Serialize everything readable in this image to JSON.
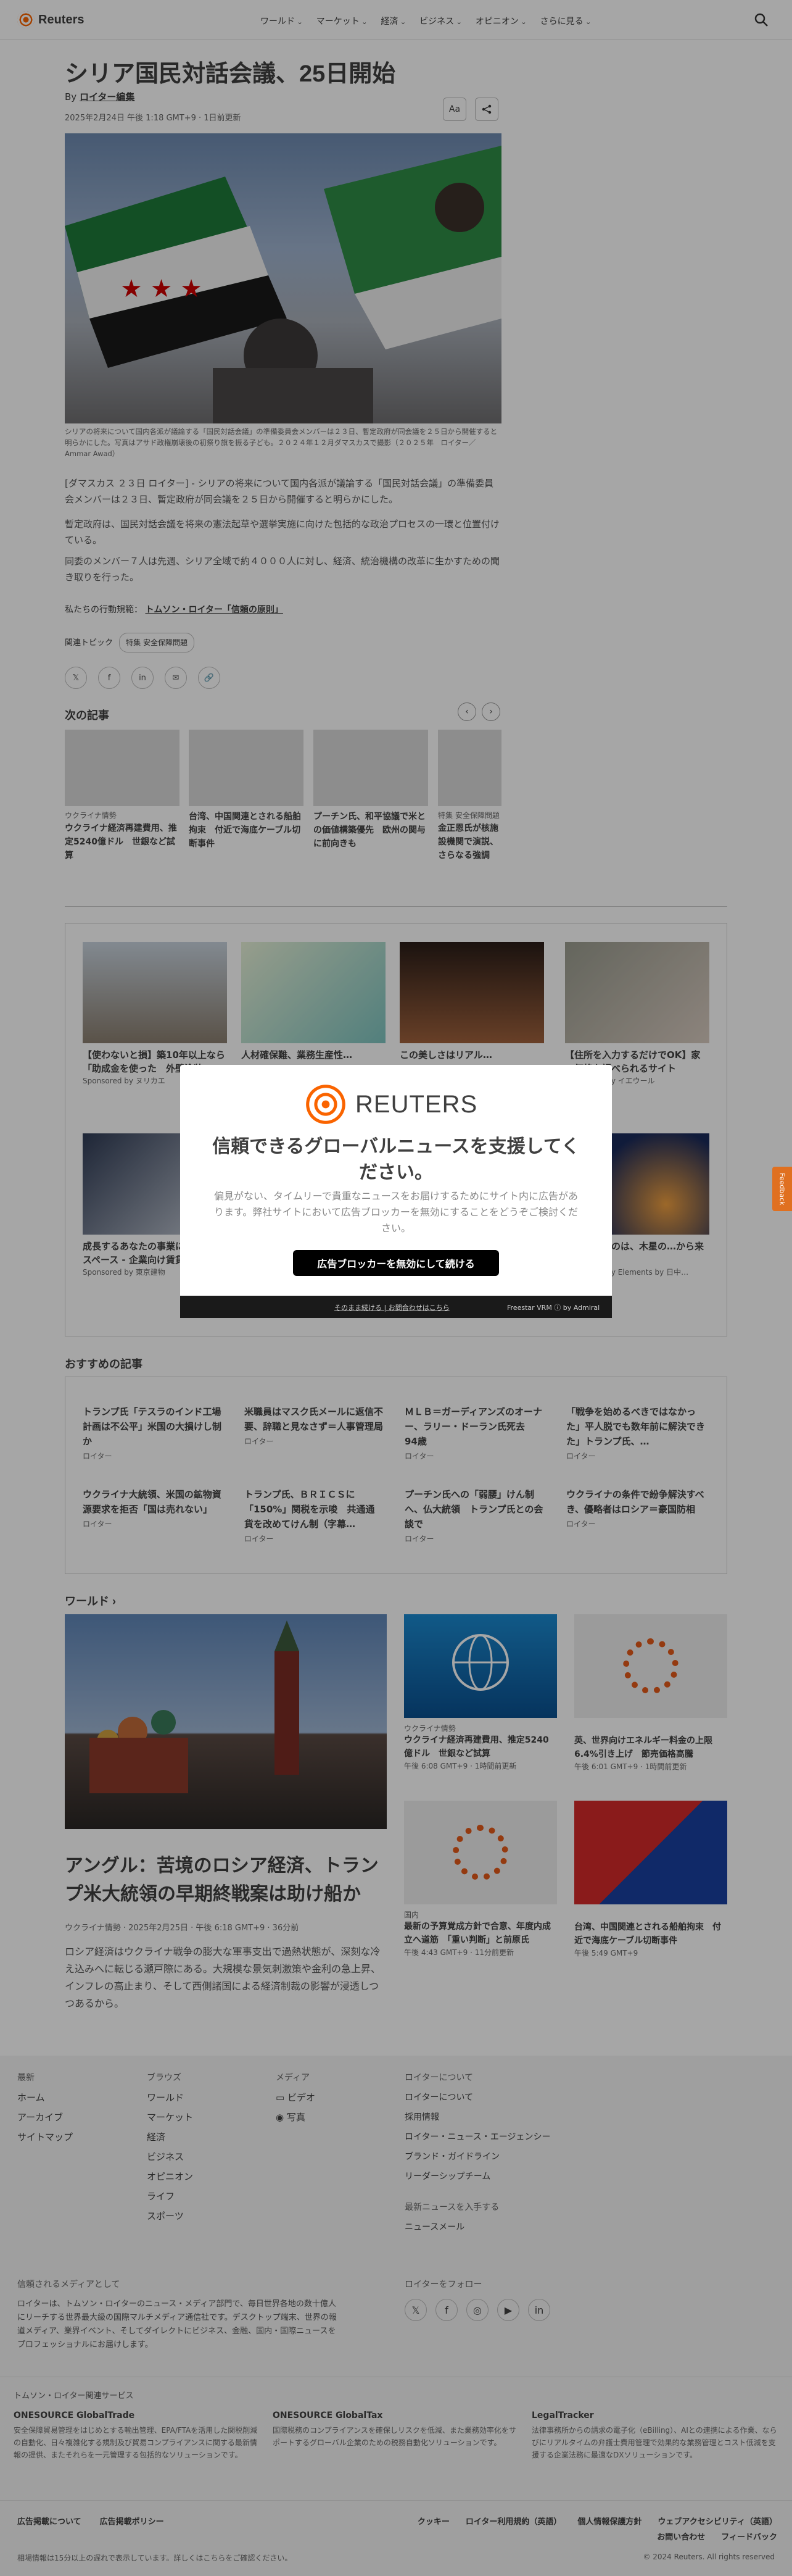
{
  "header": {
    "logo": "Reuters",
    "nav": [
      "ワールド",
      "マーケット",
      "経済",
      "ビジネス",
      "オピニオン",
      "さらに見る"
    ]
  },
  "article": {
    "title": "シリア国民対話会議、25日開始",
    "byline_prefix": "By",
    "author": "ロイター編集",
    "date": "2025年2月24日 午後 1:18 GMT+9 · 1日前更新",
    "font_button": "Aa",
    "caption": "シリアの将来について国内各派が議論する「国民対話会議」の準備委員会メンバーは２３日、暫定政府が同会議を２５日から開催すると明らかにした。写真はアサド政権崩壊後の初祭り旗を振る子ども。２０２４年１２月ダマスカスで撮影（２０２５年　ロイター／Ammar Awad）",
    "paragraphs": [
      "[ダマスカス ２３日 ロイター] - シリアの将来について国内各派が議論する「国民対話会議」の準備委員会メンバーは２３日、暫定政府が同会議を２５日から開催すると明らかにした。",
      "暫定政府は、国民対話会議を将来の憲法起草や選挙実施に向けた包括的な政治プロセスの一環と位置付けている。",
      "同委のメンバー７人は先週、シリア全域で約４０００人に対し、経済、統治機構の改革に生かすための聞き取りを行った。"
    ],
    "principles_prefix": "私たちの行動規範：",
    "principles_link": "トムソン・ロイター「信頼の原則」",
    "related_label": "関連トピック",
    "related_chip": "特集 安全保障問題"
  },
  "next_articles": {
    "title": "次の記事",
    "items": [
      {
        "category": "ウクライナ情勢",
        "headline": "ウクライナ経済再建費用、推定5240億ドル　世銀など試算"
      },
      {
        "category": "",
        "headline": "台湾、中国関連とされる船舶拘束　付近で海底ケーブル切断事件"
      },
      {
        "category": "",
        "headline": "プーチン氏、和平協議で米との価値構築優先　欧州の関与に前向きも"
      },
      {
        "category": "特集 安全保障問題",
        "headline": "金正恩氏が核施設機関で演説、さらなる強調"
      }
    ]
  },
  "ads": {
    "items": [
      {
        "headline": "【使わないと損】築10年以上なら「助成金を使った　外壁塗装」",
        "sponsor": "Sponsored by ヌリカエ"
      },
      {
        "headline": "人材確保難、業務生産性…",
        "sponsor": ""
      },
      {
        "headline": "この美しさはリアル…",
        "sponsor": ""
      },
      {
        "headline": "【住所を入力するだけでOK】家の価格を調べられるサイト",
        "sponsor": "Sponsored by イエウール"
      },
      {
        "headline": "成長するあなたの事業に合わせたスペース - 企業向け賃貸事務所",
        "sponsor": "Sponsored by 東京建物"
      },
      {
        "headline": "",
        "sponsor": ""
      },
      {
        "headline": "",
        "sponsor": ""
      },
      {
        "headline": "…減させたのは、木星の…から来た珍しい…",
        "sponsor": "Sponsored by Elements by 日中…"
      }
    ]
  },
  "modal": {
    "logo": "REUTERS",
    "heading": "信頼できるグローバルニュースを支援してください。",
    "body": "偏見がない、タイムリーで貴重なニュースをお届けするためにサイト内に広告があります。弊社サイトにおいて広告ブロッカーを無効にすることをどうぞご検討ください。",
    "button": "広告ブロッカーを無効にして続ける",
    "footer_links": "そのまま続ける | お問合わせはこちら",
    "footer_credit": "Freestar VRM ⓘ by Admiral"
  },
  "recommended": {
    "title": "おすすめの記事",
    "items": [
      {
        "headline": "トランプ氏「テスラのインド工場計画は不公平」米国の大損けし制か",
        "source": "ロイター"
      },
      {
        "headline": "米職員はマスク氏メールに返信不要、辞職と見なさず＝人事管理局",
        "source": "ロイター"
      },
      {
        "headline": "ＭＬＢ＝ガーディアンズのオーナー、ラリー・ドーラン氏死去　94歳",
        "source": "ロイター"
      },
      {
        "headline": "「戦争を始めるべきではなかった」平人脱でも数年前に解決できた」トランプ氏、…",
        "source": "ロイター"
      },
      {
        "headline": "ウクライナ大統領、米国の鉱物資源要求を拒否「国は売れない」",
        "source": "ロイター"
      },
      {
        "headline": "トランプ氏、ＢＲＩＣＳに「150%」関税を示唆　共通通貨を改めてけん制（字幕…",
        "source": "ロイター"
      },
      {
        "headline": "プーチン氏への「弱腰」けん制へ、仏大統領　トランプ氏との会談で",
        "source": "ロイター"
      },
      {
        "headline": "ウクライナの条件で紛争解決すべき、優略者はロシア＝豪国防相",
        "source": "ロイター"
      }
    ]
  },
  "world": {
    "title": "ワールド",
    "lead_headline": "アングル：苦境のロシア経済、トランプ米大統領の早期終戦案は助け船か",
    "lead_meta": "ウクライナ情勢 · 2025年2月25日 · 午後 6:18 GMT+9 · 36分前",
    "lead_summary": "ロシア経済はウクライナ戦争の膨大な軍事支出で過熱状態が、深刻な冷え込みへに転じる瀬戸際にある。大規模な景気刺激策や金利の急上昇、インフレの高止まり、そして西側諸国による経済制裁の影響が浸透しつつあるから。",
    "items": [
      {
        "category": "ウクライナ情勢",
        "headline": "ウクライナ経済再建費用、推定5240億ドル　世銀など試算",
        "time": "午後 6:08 GMT+9 · 1時間前更新"
      },
      {
        "category": "",
        "headline": "英、世界向けエネルギー料金の上限6.4%引き上げ　節売価格高騰",
        "time": "午後 6:01 GMT+9 · 1時間前更新"
      },
      {
        "category": "国内",
        "headline": "最新の予算覚成方針で合意、年度内成立へ道筋　「重い判断」と前原氏",
        "time": "午後 4:43 GMT+9 · 11分前更新"
      },
      {
        "category": "",
        "headline": "台湾、中国関連とされる船舶拘束　付近で海底ケーブル切断事件",
        "time": "午後 5:49 GMT+9"
      }
    ]
  },
  "footer": {
    "latest": {
      "title": "最新",
      "links": [
        "ホーム",
        "アーカイブ",
        "サイトマップ"
      ]
    },
    "browse": {
      "title": "ブラウズ",
      "links": [
        "ワールド",
        "マーケット",
        "経済",
        "ビジネス",
        "オピニオン",
        "ライフ",
        "スポーツ"
      ]
    },
    "media": {
      "title": "メディア",
      "links": [
        "ビデオ",
        "写真"
      ]
    },
    "about": {
      "title": "ロイターについて",
      "links": [
        "ロイターについて",
        "採用情報",
        "ロイター・ニュース・エージェンシー",
        "ブランド・ガイドライン",
        "リーダーシップチーム"
      ]
    },
    "news_title": "最新ニュースを入手する",
    "newsletter": "ニュースメール",
    "trusted_title": "信頼されるメディアとして",
    "trusted_text": "ロイターは、トムソン・ロイターのニュース・メディア部門で、毎日世界各地の数十億人にリーチする世界最大級の国際マルチメディア通信社です。デスクトップ端末、世界の報道メディア、業界イベント、そしてダイレクトにビジネス、金融、国内・国際ニュースをプロフェッショナルにお届けします。",
    "follow_title": "ロイターをフォロー",
    "tr_title": "トムソン・ロイター関連サービス",
    "services": [
      {
        "name": "ONESOURCE GlobalTrade",
        "desc": "安全保障貿易管理をはじめとする輸出管理、EPA/FTAを活用した関税削減の自動化、日々複雑化する規制及び貿易コンプライアンスに関する最新情報の提供、またそれらを一元管理する包括的なソリューションです。"
      },
      {
        "name": "ONESOURCE GlobalTax",
        "desc": "国際税務のコンプライアンスを確保しリスクを低減、また業務効率化をサポートするグローバル企業のための税務自動化ソリューションです。"
      },
      {
        "name": "LegalTracker",
        "desc": "法律事務所からの請求の電子化（eBilling）、AIとの連携による作業、ならびにリアルタイムの弁護士費用管理で効果的な業務管理とコスト低減を支援する企業法務に最適なDXソリューションです。"
      }
    ],
    "bottom_links": [
      "広告掲載について",
      "広告掲載ポリシー"
    ],
    "bottom_links_right": [
      "クッキー",
      "ロイター利用規約（英語）",
      "個人情報保護方針",
      "ウェブアクセシビリティ（英語）"
    ],
    "inquiry": "お問い合わせ",
    "feedback": "フィードバック",
    "delay_note": "相場情報は15分以上の遅れで表示しています。詳しくはこちらをご確認ください。",
    "copyright": "© 2024 Reuters. All rights reserved"
  },
  "feedback_tab": "Feedback"
}
